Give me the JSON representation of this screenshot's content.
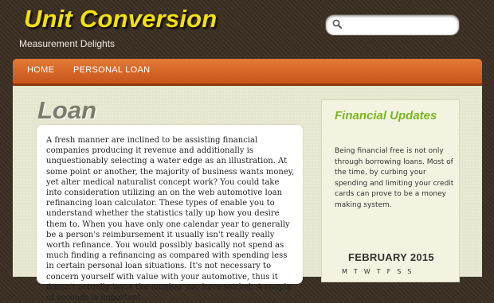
{
  "header": {
    "site_title": "Unit Conversion",
    "tagline": "Measurement Delights",
    "search": {
      "placeholder": "",
      "value": ""
    }
  },
  "nav": {
    "items": [
      {
        "label": "HOME"
      },
      {
        "label": "PERSONAL LOAN"
      }
    ]
  },
  "main": {
    "page_title": "Loan",
    "body": "A fresh manner are inclined to be assisting financial companies producing it revenue and additionally is unquestionably selecting a water edge as an illustration. At some point or another, the majority of business wants money, yet alter medical naturalist concept work? You could take into consideration utilizing an on the web automotive loan refinancing loan calculator. These types of enable you to understand whether the statistics tally up how you desire them to. When you have only one calendar year to generally be a person's reimbursement it usually isn't really really worth refinance. You would possibly basically not spend as much finding a refinancing as compared with spending less in certain personal loan situations. It's not necessary to concern yourself with value with your automotive, thus it doesn't actually issue the number you have settled. A couple of seconds is important"
  },
  "sidebar": {
    "widget_title": "Financial Updates",
    "widget_text": "Being financial free is not only through borrowing loans. Most of the time, by curbing your spending and limiting your credit cards can prove to be a money making system.",
    "calendar_title": "FEBRUARY 2015",
    "calendar_days": [
      "M",
      "T",
      "W",
      "T",
      "F",
      "S",
      "S"
    ]
  },
  "colors": {
    "title_yellow": "#f2e200",
    "nav_orange": "#d8652a",
    "widget_green": "#7ab61f",
    "background_brown": "#3b2d22"
  }
}
